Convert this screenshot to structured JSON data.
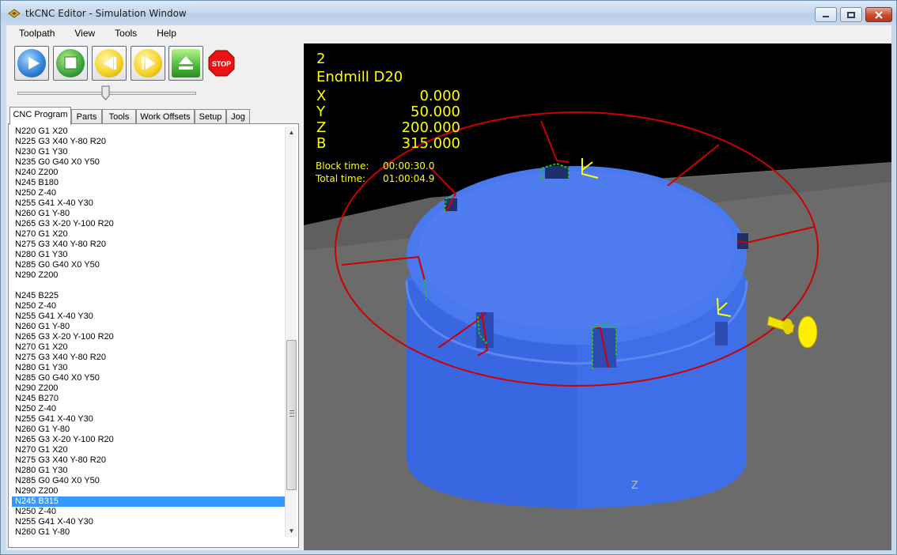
{
  "window": {
    "title": "tkCNC Editor - Simulation Window"
  },
  "menubar": {
    "items": [
      "Toolpath",
      "View",
      "Tools",
      "Help"
    ]
  },
  "toolbar": {
    "buttons": [
      "play",
      "stop",
      "step-back",
      "step-forward",
      "eject"
    ],
    "stop_label": "STOP",
    "speed_slider": 0.5
  },
  "tabs": [
    "CNC Program",
    "Parts",
    "Tools",
    "Work Offsets",
    "Setup",
    "Jog"
  ],
  "active_tab": "CNC Program",
  "program": {
    "lines": [
      "N220 G1 X20",
      "N225 G3 X40 Y-80 R20",
      "N230 G1 Y30",
      "N235 G0 G40 X0 Y50",
      "N240 Z200",
      "N245 B180",
      "N250 Z-40",
      "N255 G41 X-40 Y30",
      "N260 G1 Y-80",
      "N265 G3 X-20 Y-100 R20",
      "N270 G1 X20",
      "N275 G3 X40 Y-80 R20",
      "N280 G1 Y30",
      "N285 G0 G40 X0 Y50",
      "N290 Z200",
      "",
      "N245 B225",
      "N250 Z-40",
      "N255 G41 X-40 Y30",
      "N260 G1 Y-80",
      "N265 G3 X-20 Y-100 R20",
      "N270 G1 X20",
      "N275 G3 X40 Y-80 R20",
      "N280 G1 Y30",
      "N285 G0 G40 X0 Y50",
      "N290 Z200",
      "N245 B270",
      "N250 Z-40",
      "N255 G41 X-40 Y30",
      "N260 G1 Y-80",
      "N265 G3 X-20 Y-100 R20",
      "N270 G1 X20",
      "N275 G3 X40 Y-80 R20",
      "N280 G1 Y30",
      "N285 G0 G40 X0 Y50",
      "N290 Z200",
      "N245 B315",
      "N250 Z-40",
      "N255 G41 X-40 Y30",
      "N260 G1 Y-80"
    ],
    "selected_index": 36
  },
  "hud": {
    "tool_number": "2",
    "tool_name": "Endmill D20",
    "coords": [
      {
        "axis": "X",
        "value": "0.000"
      },
      {
        "axis": "Y",
        "value": "50.000"
      },
      {
        "axis": "Z",
        "value": "200.000"
      },
      {
        "axis": "B",
        "value": "315.000"
      }
    ],
    "block_time_label": "Block time:",
    "block_time": "00:00:30.0",
    "total_time_label": "Total time:",
    "total_time": "01:00:04.9",
    "origin_label": "Z"
  },
  "colors": {
    "part": "#4169e1",
    "toolpath": "#cc0000",
    "hud_text": "#ffff00",
    "floor": "#6e6e6e",
    "background": "#000000",
    "selection": "#3399ff"
  }
}
